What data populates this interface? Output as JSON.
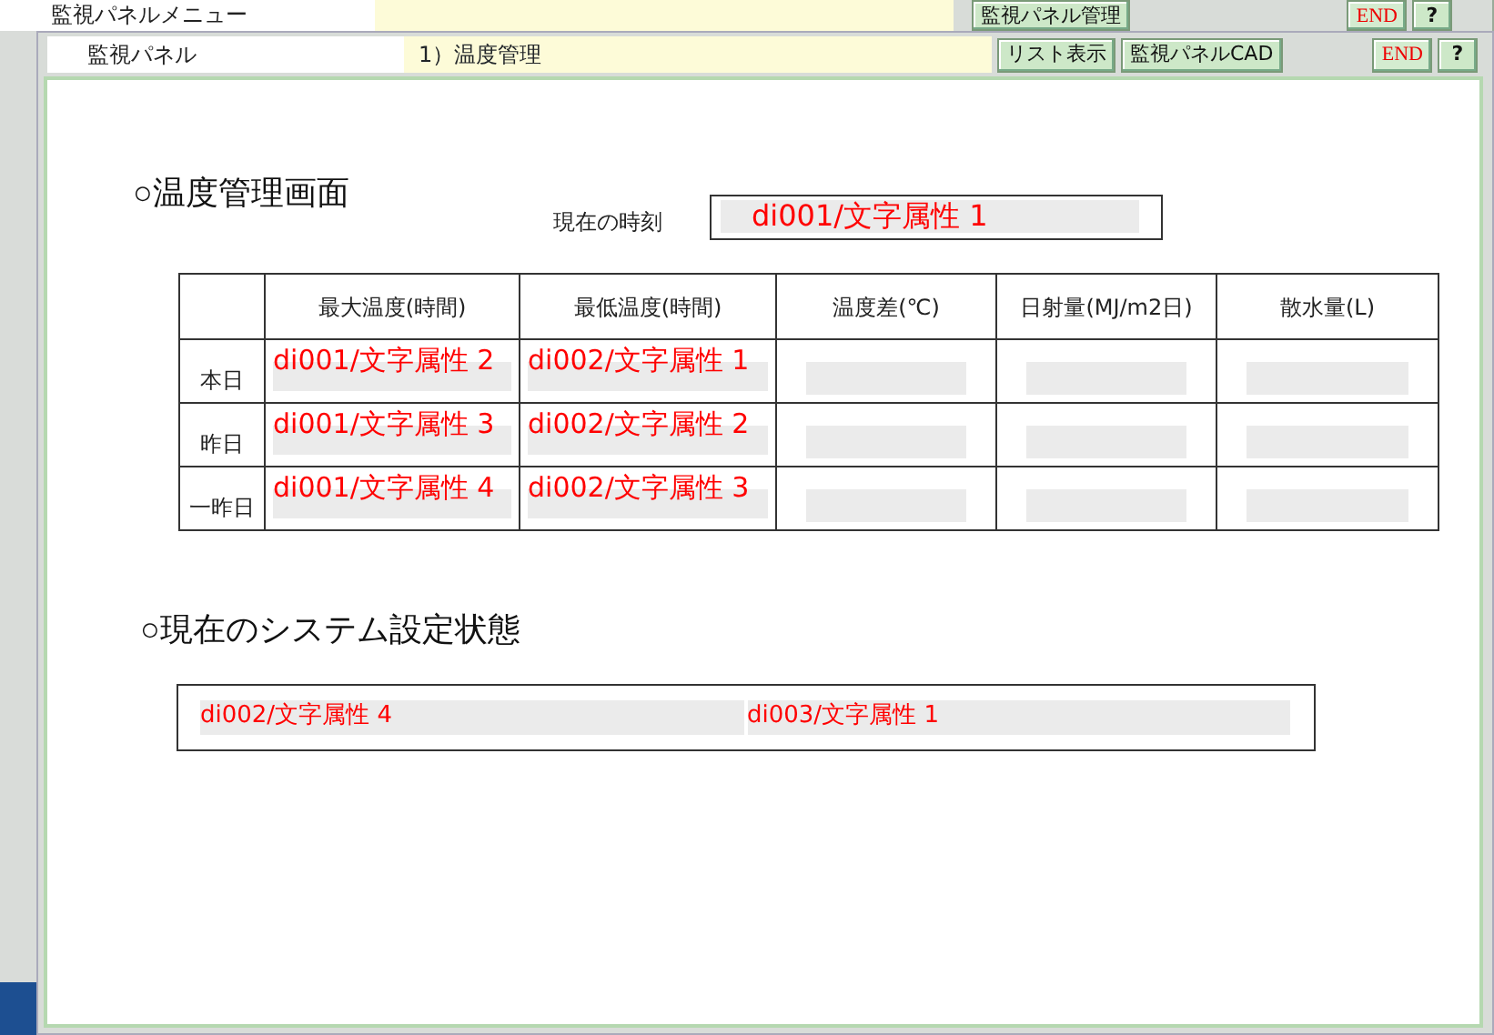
{
  "back_window": {
    "title": "監視パネルメニュー",
    "buttons": [
      {
        "label": "監視パネル管理",
        "kind": "nav"
      },
      {
        "label": "END",
        "kind": "end"
      },
      {
        "label": "?",
        "kind": "help"
      }
    ]
  },
  "window": {
    "title": "監視パネル",
    "subtitle": "1）温度管理",
    "buttons": [
      {
        "label": "リスト表示",
        "kind": "nav"
      },
      {
        "label": "監視パネルCAD",
        "kind": "nav"
      },
      {
        "label": "END",
        "kind": "end"
      },
      {
        "label": "?",
        "kind": "help"
      }
    ]
  },
  "heading": "○温度管理画面",
  "clock": {
    "label": "現在の時刻",
    "value": "di001/文字属性 1"
  },
  "table": {
    "columns": [
      "最大温度(時間)",
      "最低温度(時間)",
      "温度差(℃)",
      "日射量(MJ/m2日)",
      "散水量(L)"
    ],
    "rows": [
      {
        "label": "本日",
        "cells": [
          "di001/文字属性 2",
          "di002/文字属性 1"
        ]
      },
      {
        "label": "昨日",
        "cells": [
          "di001/文字属性 3",
          "di002/文字属性 2"
        ]
      },
      {
        "label": "一昨日",
        "cells": [
          "di001/文字属性 4",
          "di002/文字属性 3"
        ]
      }
    ]
  },
  "system": {
    "heading": "○現在のシステム設定状態",
    "fields": [
      "di002/文字属性 4",
      "di003/文字属性 1"
    ]
  }
}
